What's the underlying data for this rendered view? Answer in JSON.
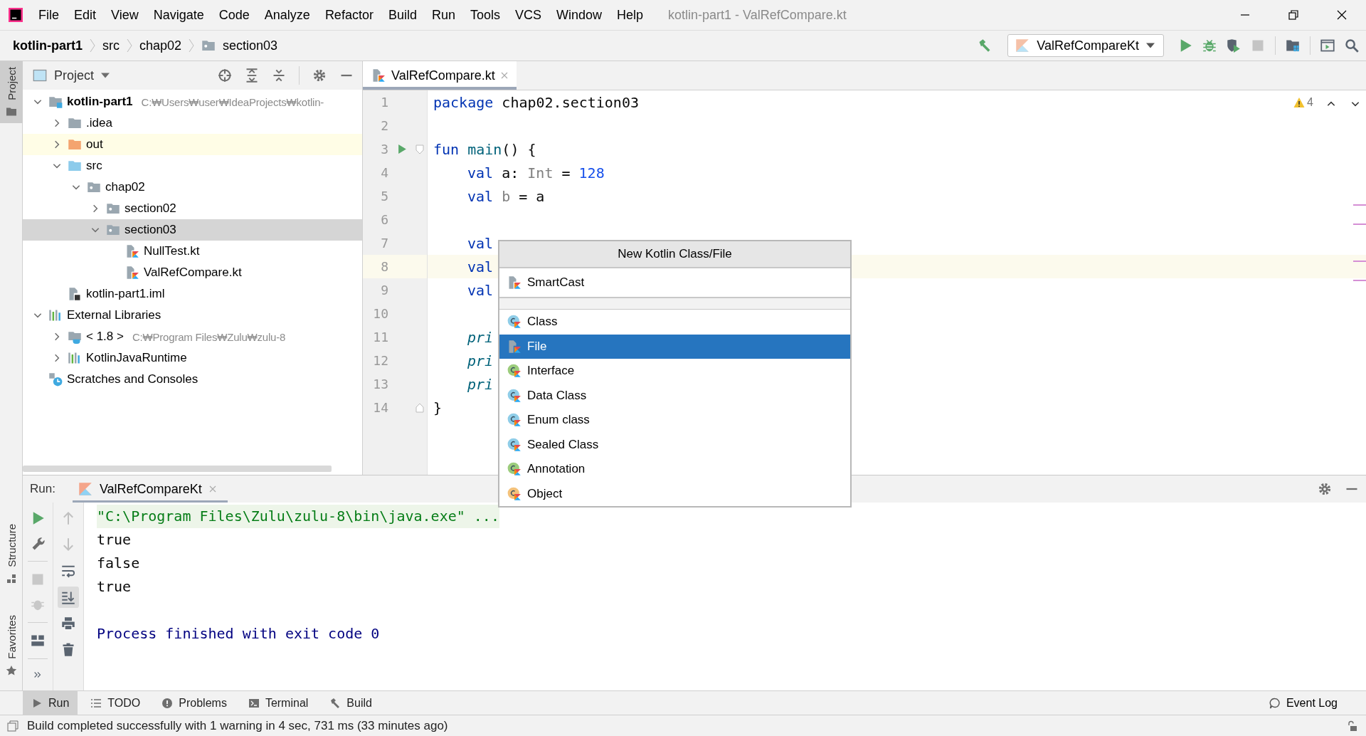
{
  "title_bar": {
    "menu": [
      "File",
      "Edit",
      "View",
      "Navigate",
      "Code",
      "Analyze",
      "Refactor",
      "Build",
      "Run",
      "Tools",
      "VCS",
      "Window",
      "Help"
    ],
    "title": "kotlin-part1 - ValRefCompare.kt"
  },
  "nav_bar": {
    "breadcrumbs": [
      {
        "label": "kotlin-part1",
        "kind": "project"
      },
      {
        "label": "src",
        "kind": "plain"
      },
      {
        "label": "chap02",
        "kind": "plain"
      },
      {
        "label": "section03",
        "kind": "package"
      }
    ],
    "run_config": "ValRefCompareKt"
  },
  "side_tabs": [
    {
      "label": "Project",
      "kind": "project",
      "selected": true
    },
    {
      "label": "Structure",
      "kind": "structure",
      "selected": false
    },
    {
      "label": "Favorites",
      "kind": "favorites",
      "selected": false
    }
  ],
  "project_panel": {
    "title": "Project",
    "tree": [
      {
        "label": "kotlin-part1",
        "kind": "project",
        "hint": "C:₩Users₩user₩IdeaProjects₩kotlin-",
        "expanded": true,
        "selected": false,
        "children": [
          {
            "label": ".idea",
            "kind": "folder",
            "expanded": false,
            "selected": false
          },
          {
            "label": "out",
            "kind": "excluded",
            "expanded": false,
            "selected": false
          },
          {
            "label": "src",
            "kind": "source",
            "expanded": true,
            "selected": false,
            "children": [
              {
                "label": "chap02",
                "kind": "package",
                "expanded": true,
                "selected": false,
                "children": [
                  {
                    "label": "section02",
                    "kind": "package",
                    "expanded": false,
                    "selected": false
                  },
                  {
                    "label": "section03",
                    "kind": "package",
                    "expanded": true,
                    "selected": true,
                    "children": [
                      {
                        "label": "NullTest.kt",
                        "kind": "kotlin",
                        "selected": false
                      },
                      {
                        "label": "ValRefCompare.kt",
                        "kind": "kotlin",
                        "selected": false
                      }
                    ]
                  }
                ]
              }
            ]
          },
          {
            "label": "kotlin-part1.iml",
            "kind": "module",
            "selected": false
          }
        ]
      },
      {
        "label": "External Libraries",
        "kind": "libraries",
        "expanded": true,
        "selected": false,
        "children": [
          {
            "label": "< 1.8 >",
            "kind": "jdk",
            "hint": "C:₩Program Files₩Zulu₩zulu-8",
            "expanded": false,
            "selected": false
          },
          {
            "label": "KotlinJavaRuntime",
            "kind": "library",
            "expanded": false,
            "selected": false
          }
        ]
      },
      {
        "label": "Scratches and Consoles",
        "kind": "scratches",
        "selected": false
      }
    ]
  },
  "editor": {
    "tabs": [
      {
        "label": "ValRefCompare.kt",
        "selected": true
      }
    ],
    "warnings": "4",
    "lines": [
      {
        "number": "1",
        "tokens": [
          {
            "text": "package",
            "kind": "keyword"
          },
          {
            "text": " chap02.section03",
            "kind": "plain"
          }
        ]
      },
      {
        "number": "2"
      },
      {
        "number": "3",
        "run": true,
        "fold_start": true,
        "tokens": [
          {
            "text": "fun",
            "kind": "keyword"
          },
          {
            "text": " main",
            "kind": "function"
          },
          {
            "text": "() {",
            "kind": "plain"
          }
        ]
      },
      {
        "number": "4",
        "indented": true,
        "tokens": [
          {
            "text": "val",
            "kind": "keyword"
          },
          {
            "text": " a: ",
            "kind": "plain"
          },
          {
            "text": "Int",
            "kind": "muted"
          },
          {
            "text": " = ",
            "kind": "plain"
          },
          {
            "text": "128",
            "kind": "number"
          }
        ]
      },
      {
        "number": "5",
        "indented": true,
        "tokens": [
          {
            "text": "val",
            "kind": "keyword"
          },
          {
            "text": " b",
            "kind": "muted"
          },
          {
            "text": " = a",
            "kind": "plain"
          }
        ]
      },
      {
        "number": "6"
      },
      {
        "number": "7",
        "indented": true,
        "tokens": [
          {
            "text": "val",
            "kind": "keyword"
          }
        ]
      },
      {
        "number": "8",
        "current": true,
        "indented": true,
        "tokens": [
          {
            "text": "val",
            "kind": "keyword"
          }
        ]
      },
      {
        "number": "9",
        "indented": true,
        "tokens": [
          {
            "text": "val",
            "kind": "keyword"
          }
        ]
      },
      {
        "number": "10"
      },
      {
        "number": "11",
        "indented": true,
        "tokens": [
          {
            "text": "pri",
            "kind": "call"
          }
        ]
      },
      {
        "number": "12",
        "indented": true,
        "tokens": [
          {
            "text": "pri",
            "kind": "call"
          }
        ]
      },
      {
        "number": "13",
        "indented": true,
        "tokens": [
          {
            "text": "pri",
            "kind": "call"
          }
        ]
      },
      {
        "number": "14",
        "fold_end": true,
        "tokens": [
          {
            "text": "}",
            "kind": "plain"
          }
        ]
      }
    ]
  },
  "popup": {
    "title": "New Kotlin Class/File",
    "recent": [
      {
        "label": "SmartCast",
        "kind": "file"
      }
    ],
    "items": [
      {
        "label": "Class",
        "kind": "class",
        "selected": false
      },
      {
        "label": "File",
        "kind": "file",
        "selected": true
      },
      {
        "label": "Interface",
        "kind": "interface",
        "selected": false
      },
      {
        "label": "Data Class",
        "kind": "class",
        "selected": false
      },
      {
        "label": "Enum class",
        "kind": "class",
        "selected": false
      },
      {
        "label": "Sealed Class",
        "kind": "class",
        "selected": false
      },
      {
        "label": "Annotation",
        "kind": "annotation",
        "selected": false
      },
      {
        "label": "Object",
        "kind": "object",
        "selected": false
      }
    ]
  },
  "run_panel": {
    "label": "Run:",
    "tabs": [
      {
        "label": "ValRefCompareKt",
        "selected": true
      }
    ],
    "console": [
      {
        "text": "\"C:\\Program Files\\Zulu\\zulu-8\\bin\\java.exe\" ...",
        "kind": "command"
      },
      {
        "text": "true",
        "kind": "output"
      },
      {
        "text": "false",
        "kind": "output"
      },
      {
        "text": "true",
        "kind": "output"
      },
      {
        "text": "Process finished with exit code 0",
        "kind": "process"
      }
    ]
  },
  "tool_tabs": [
    {
      "label": "Run",
      "kind": "run",
      "selected": true
    },
    {
      "label": "TODO",
      "kind": "todo",
      "selected": false
    },
    {
      "label": "Problems",
      "kind": "problems",
      "selected": false
    },
    {
      "label": "Terminal",
      "kind": "terminal",
      "selected": false
    },
    {
      "label": "Build",
      "kind": "build",
      "selected": false
    }
  ],
  "event_log": "Event Log",
  "status_bar": {
    "message": "Build completed successfully with 1 warning in 4 sec, 731 ms (33 minutes ago)"
  }
}
